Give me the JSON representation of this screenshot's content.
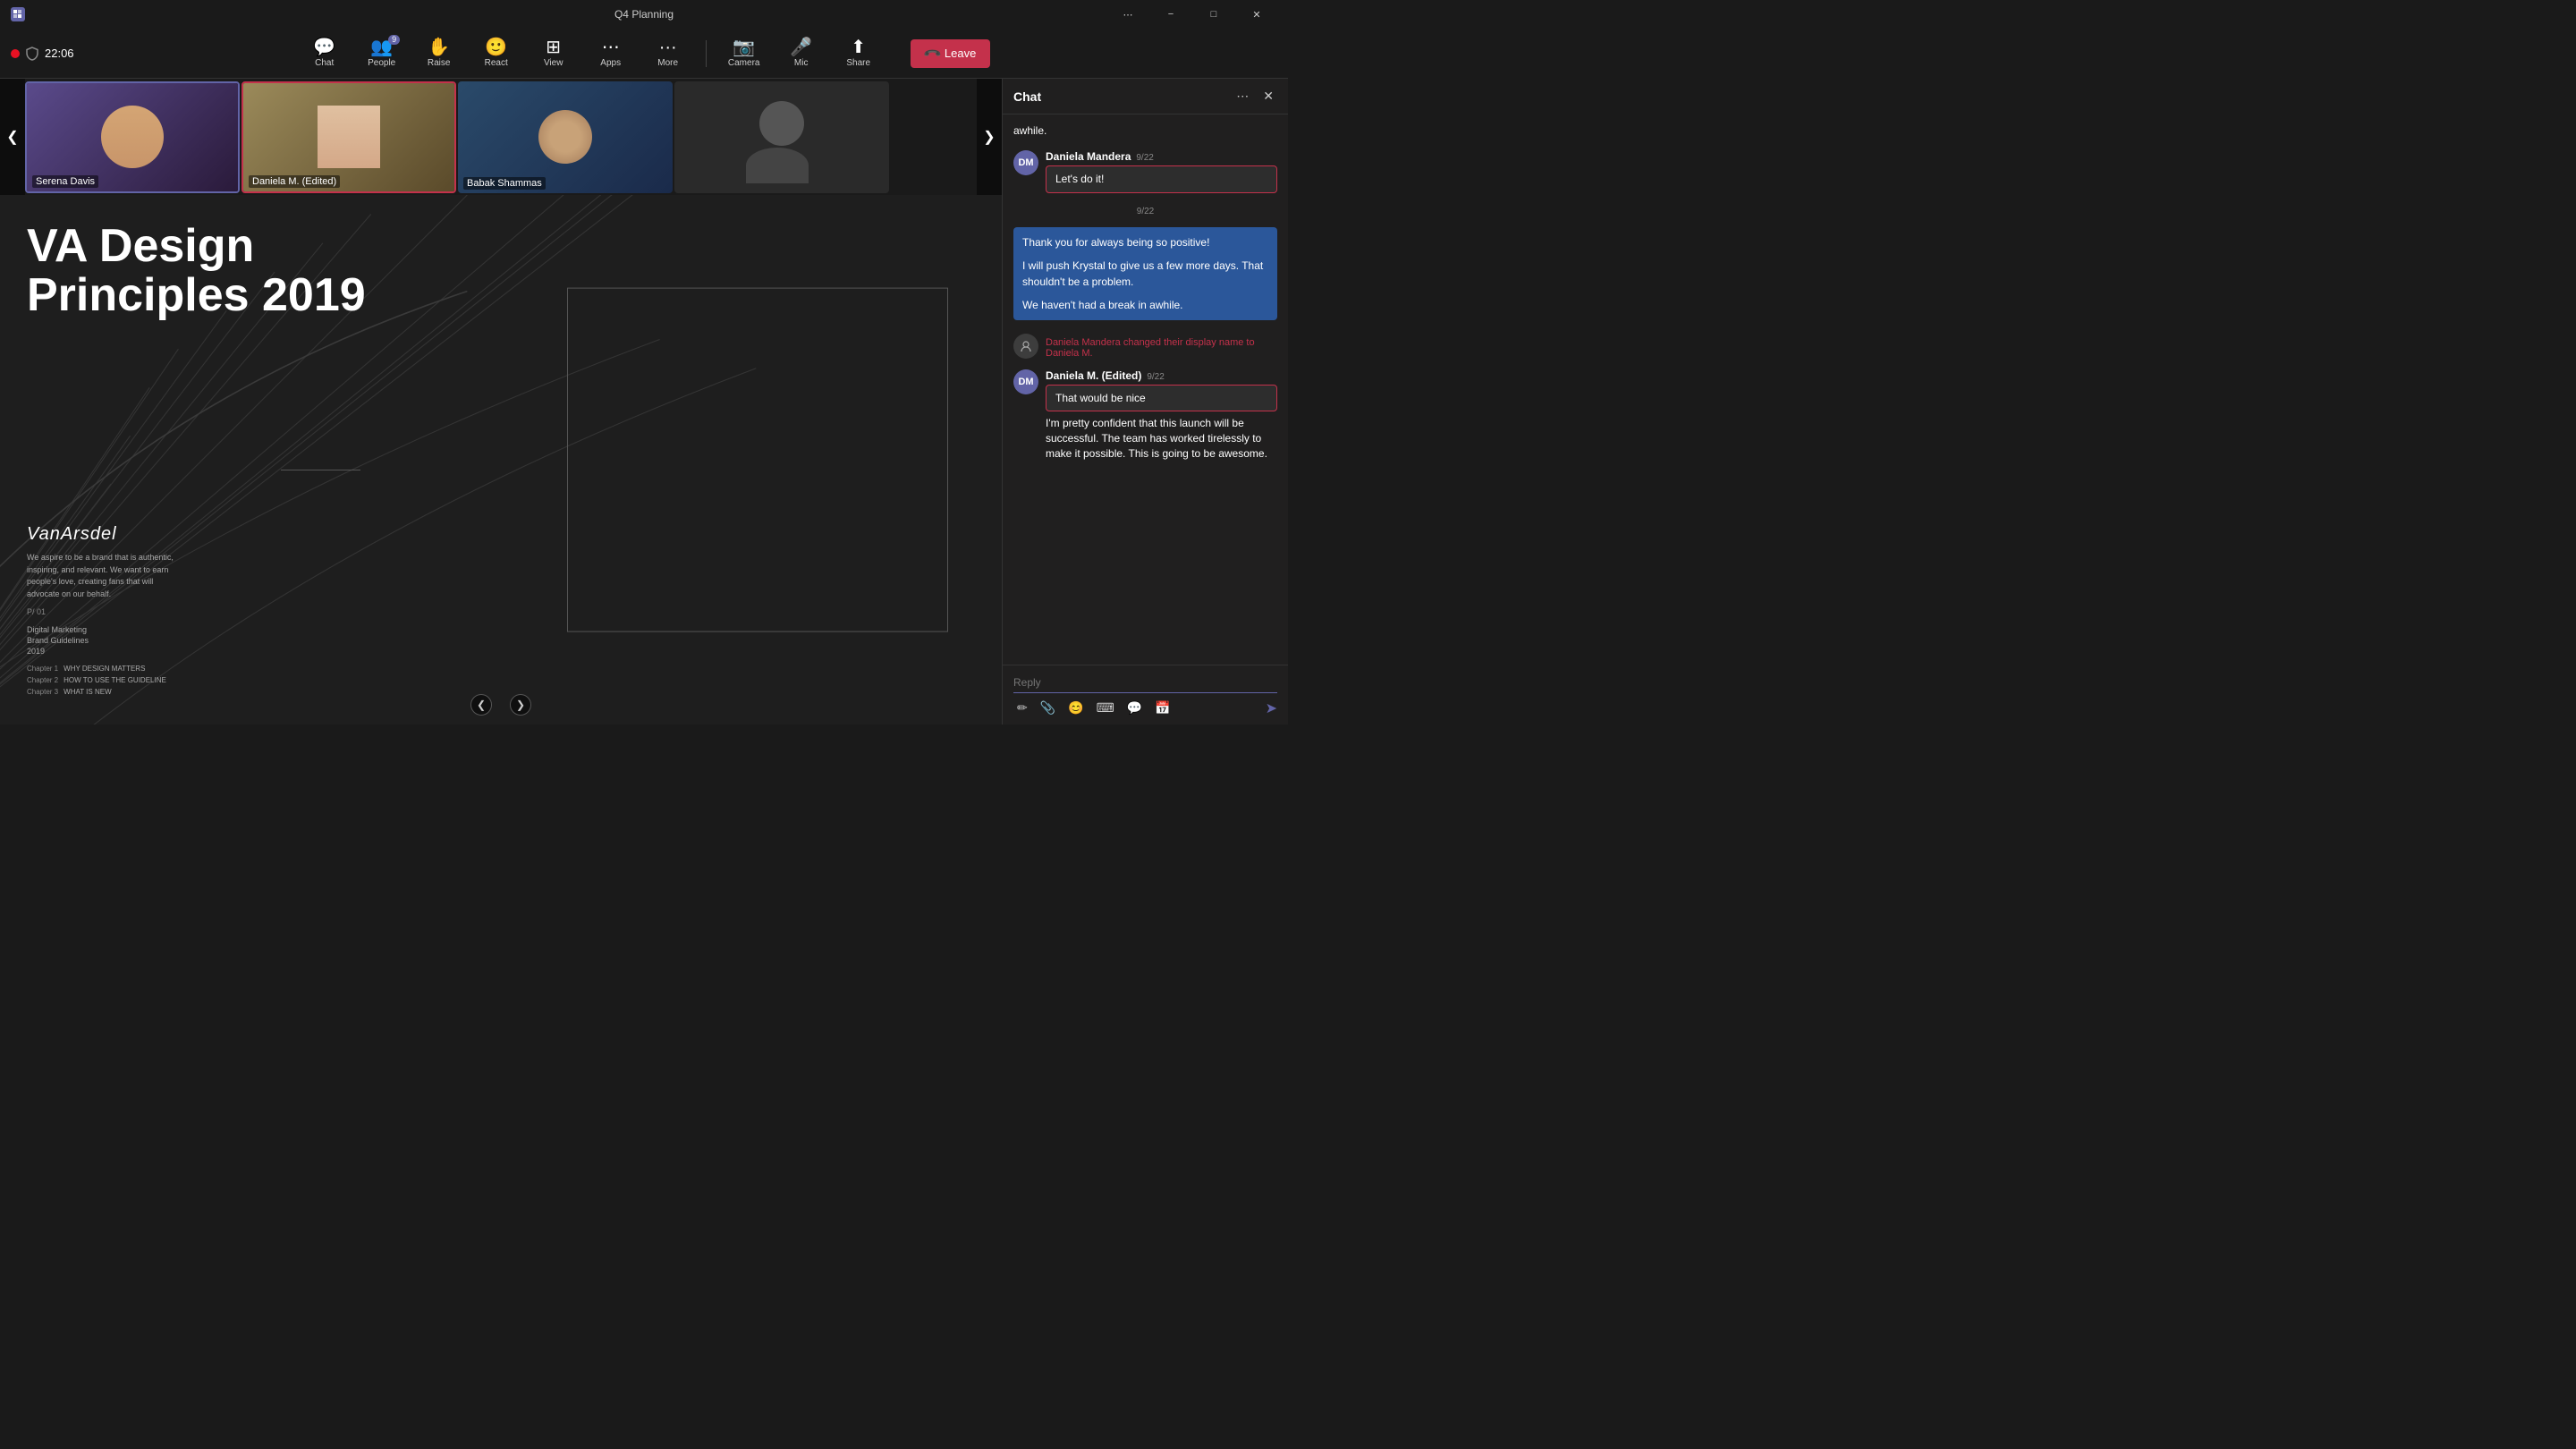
{
  "titlebar": {
    "title": "Q4 Planning",
    "more_label": "⋯",
    "minimize_label": "−",
    "maximize_label": "□",
    "close_label": "✕"
  },
  "toolbar": {
    "chat_label": "Chat",
    "people_label": "People",
    "people_count": "9",
    "raise_label": "Raise",
    "react_label": "React",
    "view_label": "View",
    "apps_label": "Apps",
    "more_label": "More",
    "camera_label": "Camera",
    "mic_label": "Mic",
    "share_label": "Share",
    "leave_label": "Leave",
    "leave_icon": "📞"
  },
  "recording": {
    "time": "22:06"
  },
  "thumbnails": {
    "prev_label": "❮",
    "next_label": "❯",
    "participants": [
      {
        "name": "Serena Davis",
        "active": true,
        "editing": false,
        "color": "#5a3e6b"
      },
      {
        "name": "Daniela M. (Edited)",
        "active": false,
        "editing": true,
        "color": "#8b6914"
      },
      {
        "name": "Babak Shammas",
        "active": false,
        "editing": false,
        "color": "#2d5a3d"
      },
      {
        "name": "",
        "active": false,
        "editing": false,
        "color": "#3d3030"
      }
    ]
  },
  "slide": {
    "title": "VA Design Principles 2019",
    "logo": "VanArsdel",
    "tagline": "We aspire to be a brand that is authentic, inspiring, and relevant. We want to earn people's love, creating fans that will advocate on our behalf.",
    "page": "P/ 01",
    "digital_marketing": "Digital Marketing",
    "brand_guidelines": "Brand Guidelines",
    "year": "2019",
    "chapter1_label": "Chapter 1",
    "chapter1_title": "WHY DESIGN MATTERS",
    "chapter2_label": "Chapter 2",
    "chapter2_title": "HOW TO USE THE GUIDELINE",
    "chapter3_label": "Chapter 3",
    "chapter3_title": "WHAT IS NEW",
    "nav_prev": "❮",
    "nav_next": "❯"
  },
  "chat": {
    "title": "Chat",
    "more_icon": "⋯",
    "close_icon": "✕",
    "messages": [
      {
        "type": "plain_continuation",
        "text": "awhile."
      },
      {
        "type": "user_msg",
        "sender": "Daniela Mandera",
        "time": "9/22",
        "bubble": "Let's do it!",
        "highlighted": true,
        "avatar_initials": "DM",
        "avatar_color": "#5a3e6b"
      },
      {
        "type": "date",
        "label": "9/22"
      },
      {
        "type": "blue_block",
        "lines": [
          "Thank you for always being so positive!",
          "",
          "I will push Krystal to give us a few more days. That shouldn't be a problem.",
          "",
          "We haven't had a break in awhile."
        ]
      },
      {
        "type": "system",
        "text": "Daniela Mandera changed their display name to Daniela M."
      },
      {
        "type": "user_msg",
        "sender": "Daniela M. (Edited)",
        "time": "9/22",
        "bubble": "That would be nice",
        "highlighted": true,
        "avatar_initials": "DM",
        "avatar_color": "#5a3e6b"
      },
      {
        "type": "plain",
        "text": "I'm pretty confident that this launch will be successful. The team has worked tirelessly to make it possible. This is going to be awesome."
      }
    ],
    "reply_placeholder": "Reply",
    "toolbar_icons": [
      "✏",
      "📎",
      "😊",
      "⌨",
      "💬",
      "📅"
    ],
    "send_icon": "➤"
  }
}
